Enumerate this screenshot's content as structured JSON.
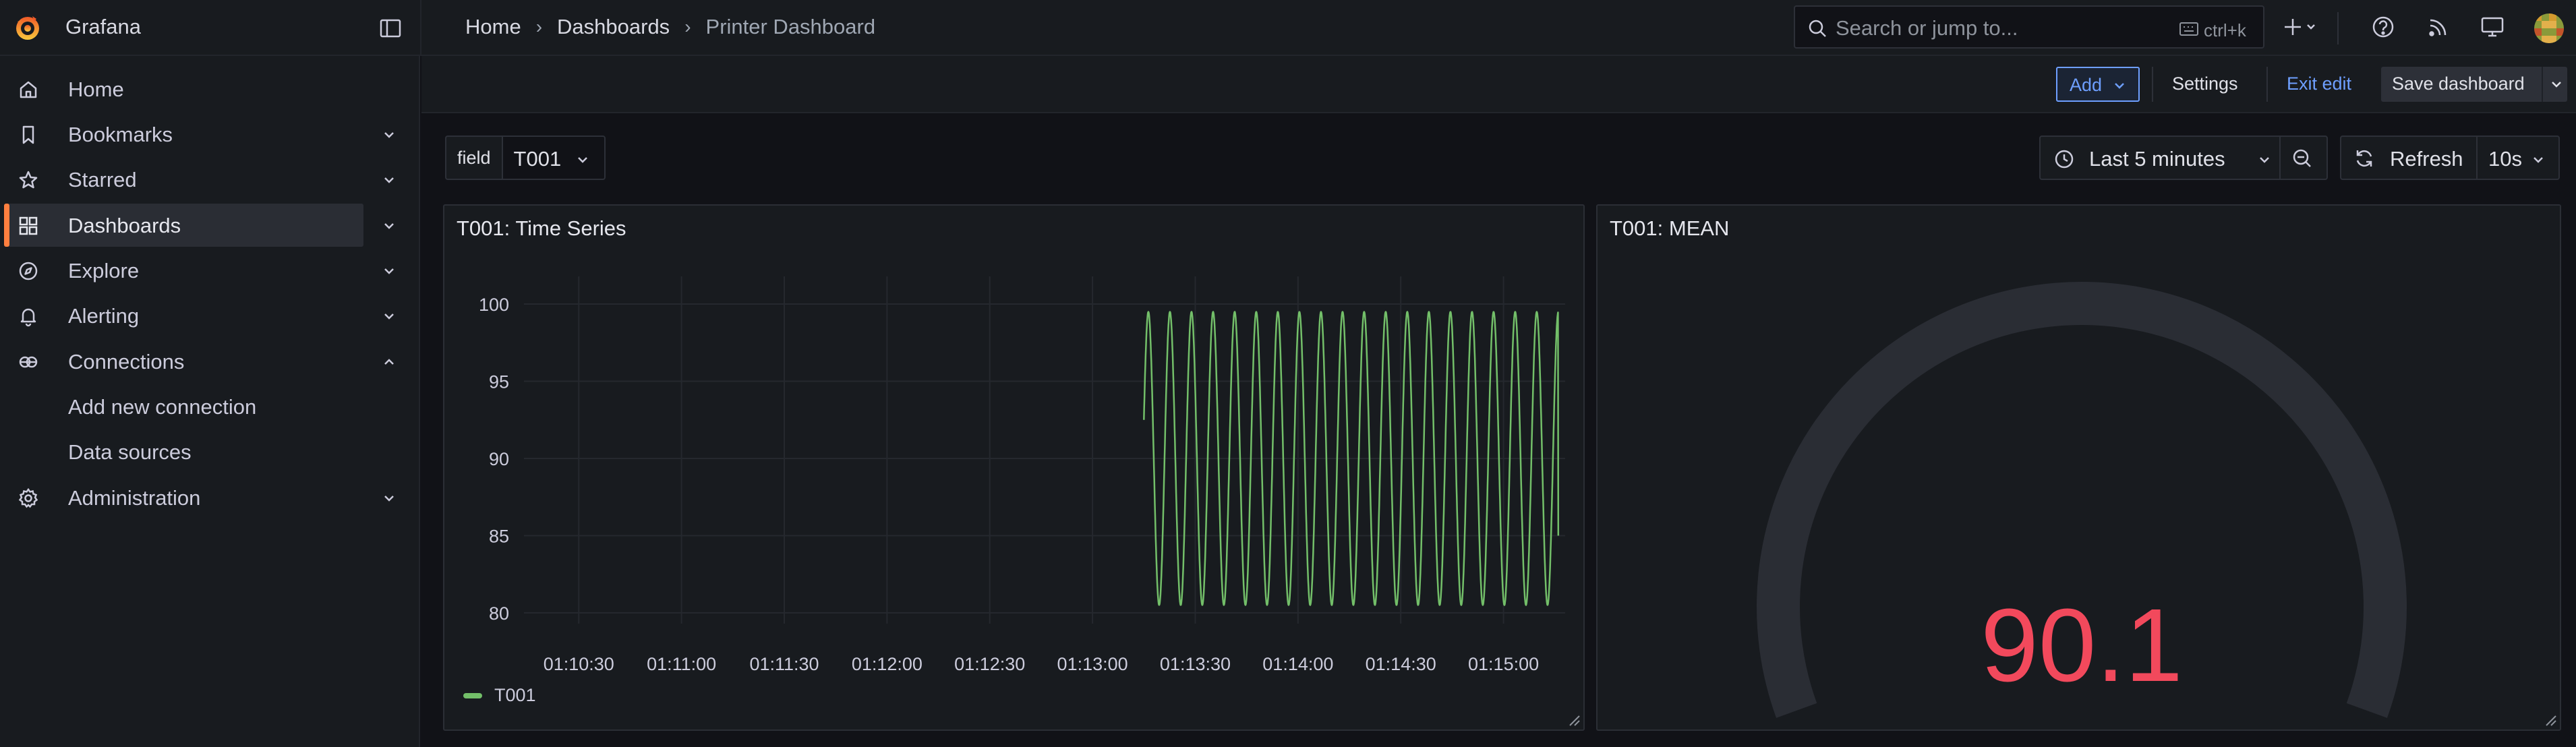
{
  "app": {
    "name": "Grafana"
  },
  "breadcrumb": [
    "Home",
    "Dashboards",
    "Printer Dashboard"
  ],
  "search": {
    "placeholder": "Search or jump to...",
    "shortcut": "ctrl+k"
  },
  "sidebar": {
    "items": [
      {
        "label": "Home",
        "icon": "home-icon",
        "chevron": ""
      },
      {
        "label": "Bookmarks",
        "icon": "bookmark-icon",
        "chevron": "down"
      },
      {
        "label": "Starred",
        "icon": "star-icon",
        "chevron": "down"
      },
      {
        "label": "Dashboards",
        "icon": "dashboards-icon",
        "chevron": "down",
        "active": true
      },
      {
        "label": "Explore",
        "icon": "compass-icon",
        "chevron": "down"
      },
      {
        "label": "Alerting",
        "icon": "bell-icon",
        "chevron": "down"
      },
      {
        "label": "Connections",
        "icon": "connections-icon",
        "chevron": "up"
      },
      {
        "label": "Administration",
        "icon": "gear-icon",
        "chevron": "down"
      }
    ],
    "subitems": [
      "Add new connection",
      "Data sources"
    ]
  },
  "toolbar": {
    "add_label": "Add",
    "settings_label": "Settings",
    "exit_edit_label": "Exit edit",
    "save_label": "Save dashboard"
  },
  "variable": {
    "label": "field",
    "value": "T001"
  },
  "time_picker": {
    "label": "Last 5 minutes"
  },
  "refresh": {
    "label": "Refresh",
    "interval": "10s"
  },
  "colors": {
    "accent": "#ff7f3f",
    "series": "#73bf69",
    "gauge_value": "#f2495c",
    "link": "#6e9fff"
  },
  "panels": {
    "timeseries": {
      "title": "T001: Time Series",
      "legend": "T001"
    },
    "gauge": {
      "title": "T001: MEAN",
      "value": "90.1",
      "fraction": 0.0
    }
  },
  "chart_data": {
    "type": "line",
    "title": "T001: Time Series",
    "xlabel": "",
    "ylabel": "",
    "x_ticks": [
      "01:10:30",
      "01:11:00",
      "01:11:30",
      "01:12:00",
      "01:12:30",
      "01:13:00",
      "01:13:30",
      "01:14:00",
      "01:14:30",
      "01:15:00"
    ],
    "y_ticks": [
      80,
      85,
      90,
      95,
      100
    ],
    "ylim": [
      80,
      100
    ],
    "xlim_seconds_from_0110": [
      14,
      318
    ],
    "series": [
      {
        "name": "T001",
        "start": "01:13:15",
        "end": "01:15:16",
        "period_seconds": 6.3,
        "min": 80.5,
        "max": 99.5,
        "start_value": 92.5,
        "end_value": 85
      }
    ],
    "grid": true,
    "legend": "bottom-left"
  }
}
